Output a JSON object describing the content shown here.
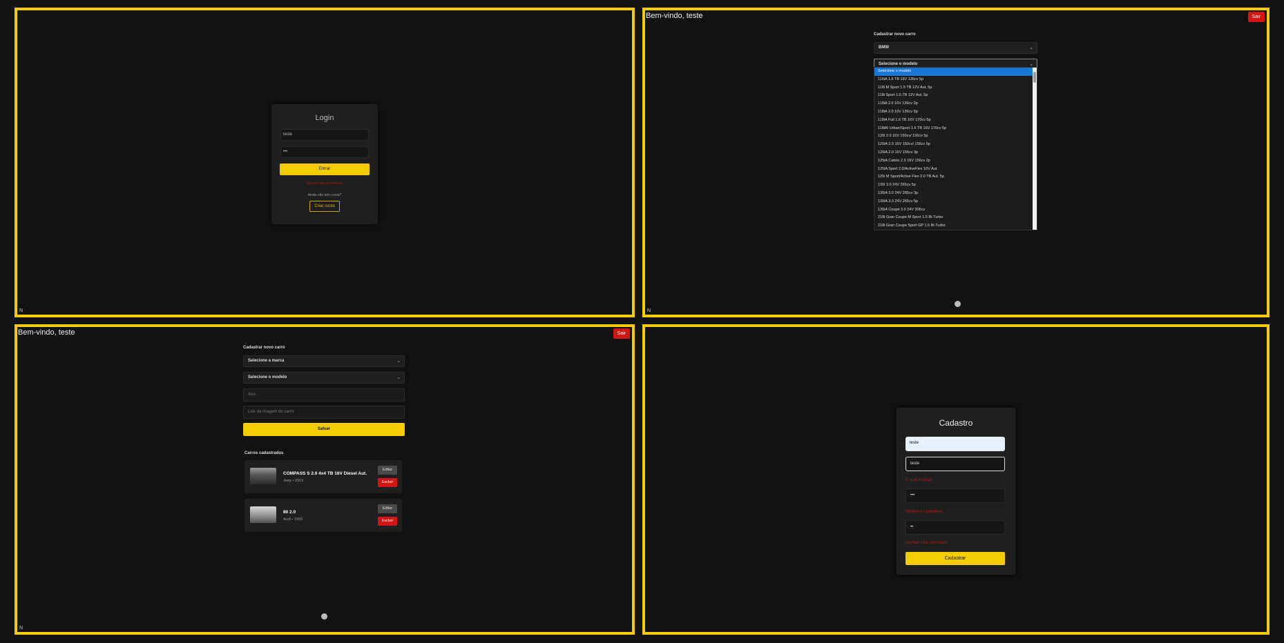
{
  "login": {
    "title": "Login",
    "username_value": "teste",
    "password_value": "•••",
    "submit_label": "Entrar",
    "error": "Usuário não encontrado",
    "no_account_question": "Ainda não tem conta?",
    "create_account_label": "Criar conta"
  },
  "dashboard": {
    "welcome": "Bem-vindo, teste",
    "logout_label": "Sair",
    "form_title": "Cadastrar novo carro",
    "brand_select_value": "BMW",
    "brand_placeholder": "Selecione a marca",
    "model_placeholder": "Selecione o modelo",
    "year_placeholder": "Ano",
    "image_placeholder": "Link da imagem do carro",
    "save_label": "Salvar",
    "cars_title": "Carros cadastrados",
    "cars": [
      {
        "name": "COMPASS S 2.0 4x4 TB 16V Diesel Aut.",
        "subtitle": "Jeep • 2019",
        "edit_label": "Editar",
        "delete_label": "Excluir"
      },
      {
        "name": "80 2.0",
        "subtitle": "Audi • 1993",
        "edit_label": "Editar",
        "delete_label": "Excluir"
      }
    ],
    "model_options": [
      "Selecione o modelo",
      "116iA 1.6 TB 16V 136cv 5p",
      "118i M Sport 1.5 TB 12V Aut. 5p",
      "118i Sport 1.5 TB 12V Aut. 5p",
      "118iA 2.0 16V 136cv 3p",
      "118iA 2.0 16V 136cv 5p",
      "118iA Full 1.6 TB 16V 170cv 5p",
      "118iA/ Urban/Sport 1.6 TB 16V 170cv 5p",
      "120i 2.0 16V 150cv/ 156cv 5p",
      "120iA 2.0 16V 150cv/ 156cv 5p",
      "120iA 2.0 16V 156cv 3p",
      "125iA Cabrio 2.0 16V 156cv 2p",
      "125iA Sport 2.0/ActiveFlex 16V Aut.",
      "125i M Sport/Active Flex 2.0 TB Aut. 5p",
      "130i 3.0 24V 265cv 5p",
      "130iA 3.0 24V 265cv 3p",
      "130iA 3.0 24V 265cv 5p",
      "135iA Coupé 3.0 24V 306cv",
      "218i Gran Coupe M Sport 1.5 Bi-Turbo",
      "218i Gran Coupe Sport GP 1.5 Bi-Turbo"
    ]
  },
  "register": {
    "title": "Cadastro",
    "name_value": "teste",
    "email_value": "teste",
    "email_error": "E-mail inválido",
    "password_value": "•••",
    "password_error": "Mínimo 6 caracteres",
    "confirm_value": "••",
    "confirm_error": "Senhas não coincidem",
    "submit_label": "Cadastrar"
  },
  "colors": {
    "accent": "#f5cc00",
    "danger": "#d21414",
    "background": "#121212",
    "card": "#1f1f1f",
    "selected": "#1976d2"
  }
}
